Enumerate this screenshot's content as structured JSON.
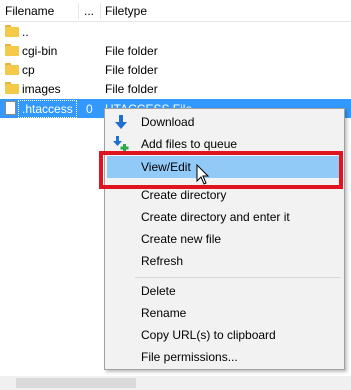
{
  "columns": {
    "filename": "Filename",
    "size": "...",
    "filetype": "Filetype"
  },
  "rows": [
    {
      "name": "..",
      "size": "",
      "type": "",
      "icon": "folder-icon"
    },
    {
      "name": "cgi-bin",
      "size": "",
      "type": "File folder",
      "icon": "folder-icon"
    },
    {
      "name": "cp",
      "size": "",
      "type": "File folder",
      "icon": "folder-icon"
    },
    {
      "name": "images",
      "size": "",
      "type": "File folder",
      "icon": "folder-icon"
    },
    {
      "name": ".htaccess",
      "size": "0",
      "type": "HTACCESS File",
      "icon": "file-icon",
      "selected": true
    }
  ],
  "context_menu": {
    "items": [
      {
        "label": "Download",
        "icon": "download-arrow-icon"
      },
      {
        "label": "Add files to queue",
        "icon": "add-to-queue-icon"
      },
      {
        "label": "View/Edit",
        "highlighted": true
      },
      {
        "label": "Create directory"
      },
      {
        "label": "Create directory and enter it"
      },
      {
        "label": "Create new file"
      },
      {
        "label": "Refresh"
      },
      {
        "label": "Delete"
      },
      {
        "label": "Rename"
      },
      {
        "label": "Copy URL(s) to clipboard"
      },
      {
        "label": "File permissions..."
      }
    ]
  },
  "colors": {
    "selection": "#3399ff",
    "menu_highlight": "#91c9f7",
    "annotation_box": "#e0141e",
    "folder": "#f5c94a"
  }
}
